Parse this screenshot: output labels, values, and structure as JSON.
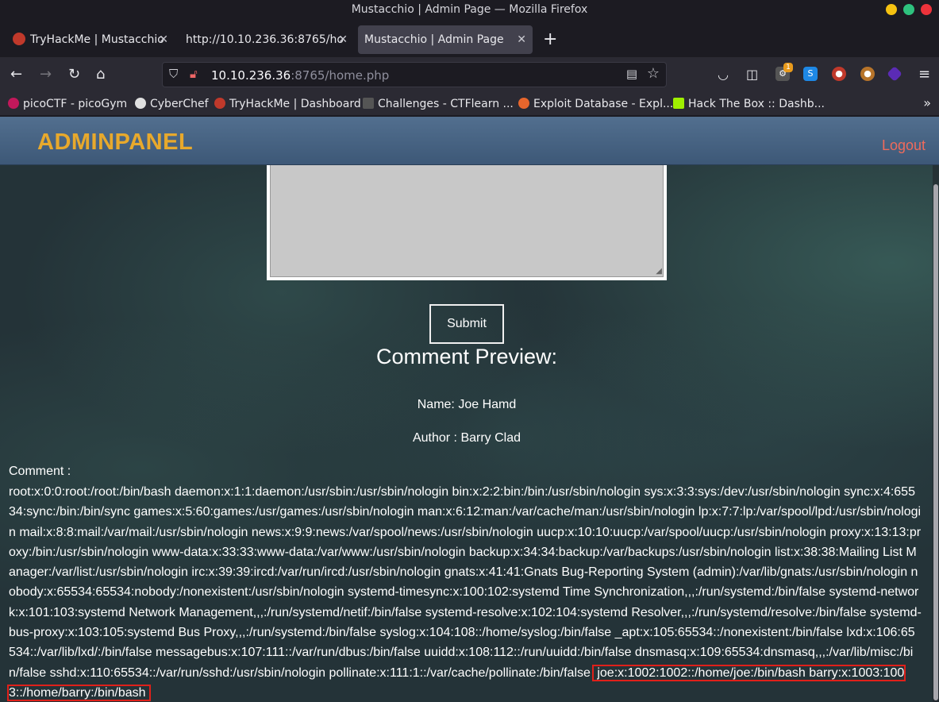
{
  "browser": {
    "window_title": "Mustacchio | Admin Page — Mozilla Firefox",
    "tabs": [
      {
        "label": "TryHackMe | Mustacchio",
        "active": false
      },
      {
        "label": "http://10.10.236.36:8765/ho",
        "active": false
      },
      {
        "label": "Mustacchio | Admin Page",
        "active": true
      }
    ],
    "url_host": "10.10.236.36",
    "url_rest": ":8765/home.php",
    "bookmarks": [
      "picoCTF - picoGym",
      "CyberChef",
      "TryHackMe | Dashboard",
      "Challenges - CTFlearn ...",
      "Exploit Database - Expl...",
      "Hack The Box :: Dashb..."
    ],
    "ext_badge": "1"
  },
  "page": {
    "brand": "ADMINPANEL",
    "logout": "Logout",
    "submit_label": "Submit",
    "preview_heading": "Comment Preview:",
    "name_line": "Name: Joe Hamd",
    "author_line": "Author : Barry Clad",
    "comment_label": "Comment :",
    "comment_text": "root:x:0:0:root:/root:/bin/bash daemon:x:1:1:daemon:/usr/sbin:/usr/sbin/nologin bin:x:2:2:bin:/bin:/usr/sbin/nologin sys:x:3:3:sys:/dev:/usr/sbin/nologin sync:x:4:65534:sync:/bin:/bin/sync games:x:5:60:games:/usr/games:/usr/sbin/nologin man:x:6:12:man:/var/cache/man:/usr/sbin/nologin lp:x:7:7:lp:/var/spool/lpd:/usr/sbin/nologin mail:x:8:8:mail:/var/mail:/usr/sbin/nologin news:x:9:9:news:/var/spool/news:/usr/sbin/nologin uucp:x:10:10:uucp:/var/spool/uucp:/usr/sbin/nologin proxy:x:13:13:proxy:/bin:/usr/sbin/nologin www-data:x:33:33:www-data:/var/www:/usr/sbin/nologin backup:x:34:34:backup:/var/backups:/usr/sbin/nologin list:x:38:38:Mailing List Manager:/var/list:/usr/sbin/nologin irc:x:39:39:ircd:/var/run/ircd:/usr/sbin/nologin gnats:x:41:41:Gnats Bug-Reporting System (admin):/var/lib/gnats:/usr/sbin/nologin nobody:x:65534:65534:nobody:/nonexistent:/usr/sbin/nologin systemd-timesync:x:100:102:systemd Time Synchronization,,,:/run/systemd:/bin/false systemd-network:x:101:103:systemd Network Management,,,:/run/systemd/netif:/bin/false systemd-resolve:x:102:104:systemd Resolver,,,:/run/systemd/resolve:/bin/false systemd-bus-proxy:x:103:105:systemd Bus Proxy,,,:/run/systemd:/bin/false syslog:x:104:108::/home/syslog:/bin/false _apt:x:105:65534::/nonexistent:/bin/false lxd:x:106:65534::/var/lib/lxd/:/bin/false messagebus:x:107:111::/var/run/dbus:/bin/false uuidd:x:108:112::/run/uuidd:/bin/false dnsmasq:x:109:65534:dnsmasq,,,:/var/lib/misc:/bin/false sshd:x:110:65534::/var/run/sshd:/usr/sbin/nologin pollinate:x:111:1::/var/cache/pollinate:/bin/false",
    "comment_highlight": "joe:x:1002:1002::/home/joe:/bin/bash barry:x:1003:1003::/home/barry:/bin/bash"
  },
  "colors": {
    "brand": "#e8a92c",
    "logout": "#ef6b5c",
    "header_bg": "#4a6888",
    "highlight_box": "#e0201a"
  }
}
